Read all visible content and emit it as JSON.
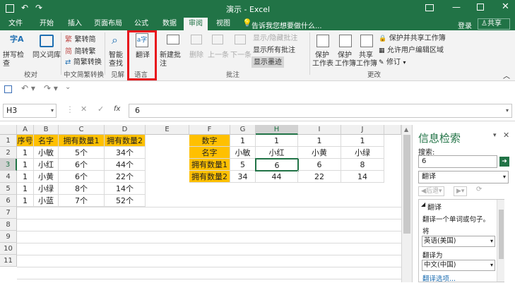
{
  "window": {
    "title": "演示 - Excel",
    "signin": "登录",
    "share": "共享"
  },
  "tabs": [
    "文件",
    "开始",
    "插入",
    "页面布局",
    "公式",
    "数据",
    "审阅",
    "视图"
  ],
  "tell_me": "告诉我您想要做什么...",
  "ribbon": {
    "spell": "拼写检查",
    "thesaurus": "同义词库",
    "group_proof": "校对",
    "trad_to_simp": "繁转简",
    "simp_to_trad": "简转繁",
    "convert": "简繁转换",
    "group_chinese": "中文简繁转换",
    "smart_lookup_1": "智能",
    "smart_lookup_2": "查找",
    "group_insights": "见解",
    "translate": "翻译",
    "group_language": "语言",
    "new_comment": "新建批注",
    "delete": "删除",
    "prev": "上一条",
    "next": "下一条",
    "show_hide_comment": "显示/隐藏批注",
    "show_all_comments": "显示所有批注",
    "show_ink": "显示墨迹",
    "group_comments": "批注",
    "protect_sheet_1": "保护",
    "protect_sheet_2": "工作表",
    "protect_book_1": "保护",
    "protect_book_2": "工作簿",
    "share_book_1": "共享",
    "share_book_2": "工作簿",
    "protect_share": "保护并共享工作簿",
    "allow_edit": "允许用户编辑区域",
    "track": "修订",
    "group_changes": "更改"
  },
  "formula_bar": {
    "name_box": "H3",
    "fx": "fx",
    "value": "6"
  },
  "columns": [
    "A",
    "B",
    "C",
    "D",
    "E",
    "F",
    "G",
    "H",
    "I",
    "J"
  ],
  "rows": [
    "1",
    "2",
    "3",
    "4",
    "5",
    "6",
    "7",
    "8",
    "9",
    "10",
    "11"
  ],
  "table_left": {
    "header": [
      "序号",
      "名字",
      "拥有数量1",
      "拥有数量2"
    ],
    "rows": [
      [
        "1",
        "小敏",
        "5个",
        "34个"
      ],
      [
        "1",
        "小红",
        "6个",
        "44个"
      ],
      [
        "1",
        "小黄",
        "6个",
        "22个"
      ],
      [
        "1",
        "小绿",
        "8个",
        "14个"
      ],
      [
        "1",
        "小蓝",
        "7个",
        "52个"
      ]
    ]
  },
  "table_right": {
    "row_labels": [
      "数字",
      "名字",
      "拥有数量1",
      "拥有数量2"
    ],
    "cols": [
      [
        "1",
        "小敏",
        "5",
        "34"
      ],
      [
        "1",
        "小红",
        "6",
        "44"
      ],
      [
        "1",
        "小黄",
        "6",
        "22"
      ],
      [
        "1",
        "小绿",
        "8",
        "14"
      ]
    ]
  },
  "pane": {
    "title": "信息检索",
    "search_label": "搜索:",
    "search_value": "6",
    "service": "翻译",
    "back": "后退",
    "section": "翻译",
    "desc": "翻译一个单词或句子。",
    "from_label": "将",
    "from_value": "英语(美国)",
    "to_label": "翻译为",
    "to_value": "中文(中国)",
    "options": "翻译选项..."
  },
  "colors": {
    "excel_green": "#217346",
    "highlight_yellow": "#ffc000",
    "red_box": "#e8141c"
  }
}
